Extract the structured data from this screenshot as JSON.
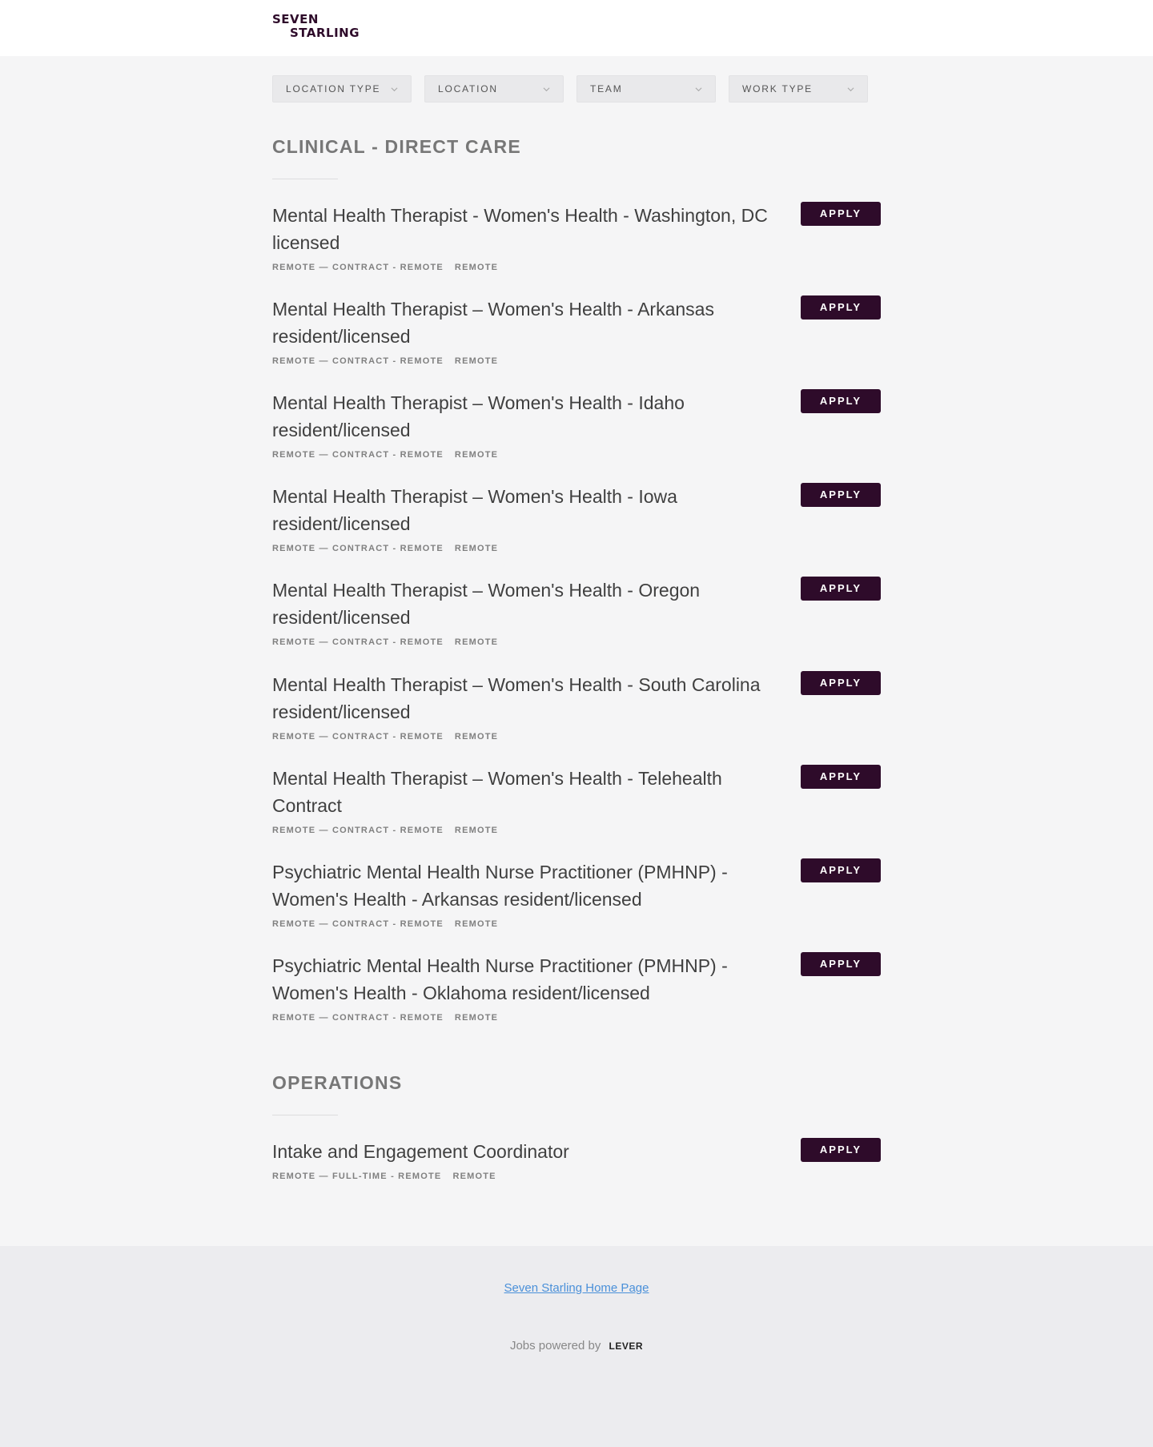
{
  "header": {
    "logo_line1": "SEVEN",
    "logo_line2": "STARLING"
  },
  "filters": {
    "location_type": "LOCATION TYPE",
    "location": "LOCATION",
    "team": "TEAM",
    "work_type": "WORK TYPE"
  },
  "sections": [
    {
      "title": "CLINICAL - DIRECT CARE",
      "postings": [
        {
          "title": "Mental Health Therapist - Women's Health - Washington, DC licensed",
          "meta": "REMOTE — CONTRACT - REMOTE",
          "location": "REMOTE",
          "apply": "APPLY"
        },
        {
          "title": "Mental Health Therapist – Women's Health - Arkansas resident/licensed",
          "meta": "REMOTE — CONTRACT - REMOTE",
          "location": "REMOTE",
          "apply": "APPLY"
        },
        {
          "title": "Mental Health Therapist – Women's Health - Idaho resident/licensed",
          "meta": "REMOTE — CONTRACT - REMOTE",
          "location": "REMOTE",
          "apply": "APPLY"
        },
        {
          "title": "Mental Health Therapist – Women's Health - Iowa resident/licensed",
          "meta": "REMOTE — CONTRACT - REMOTE",
          "location": "REMOTE",
          "apply": "APPLY"
        },
        {
          "title": "Mental Health Therapist – Women's Health - Oregon resident/licensed",
          "meta": "REMOTE — CONTRACT - REMOTE",
          "location": "REMOTE",
          "apply": "APPLY"
        },
        {
          "title": "Mental Health Therapist – Women's Health - South Carolina resident/licensed",
          "meta": "REMOTE — CONTRACT - REMOTE",
          "location": "REMOTE",
          "apply": "APPLY"
        },
        {
          "title": "Mental Health Therapist – Women's Health - Telehealth Contract",
          "meta": "REMOTE — CONTRACT - REMOTE",
          "location": "REMOTE",
          "apply": "APPLY"
        },
        {
          "title": "Psychiatric Mental Health Nurse Practitioner (PMHNP) - Women's Health - Arkansas resident/licensed",
          "meta": "REMOTE — CONTRACT - REMOTE",
          "location": "REMOTE",
          "apply": "APPLY"
        },
        {
          "title": "Psychiatric Mental Health Nurse Practitioner (PMHNP) - Women's Health - Oklahoma resident/licensed",
          "meta": "REMOTE — CONTRACT - REMOTE",
          "location": "REMOTE",
          "apply": "APPLY"
        }
      ]
    },
    {
      "title": "OPERATIONS",
      "postings": [
        {
          "title": "Intake and Engagement Coordinator",
          "meta": "REMOTE — FULL-TIME - REMOTE",
          "location": "REMOTE",
          "apply": "APPLY"
        }
      ]
    }
  ],
  "footer": {
    "home_link": "Seven Starling Home Page",
    "powered_by": "Jobs powered by",
    "lever": "LEVER"
  },
  "colors": {
    "brand": "#2e0b2a",
    "link": "#4a90d9",
    "background": "#f5f5f6",
    "footer_background": "#ececef"
  }
}
